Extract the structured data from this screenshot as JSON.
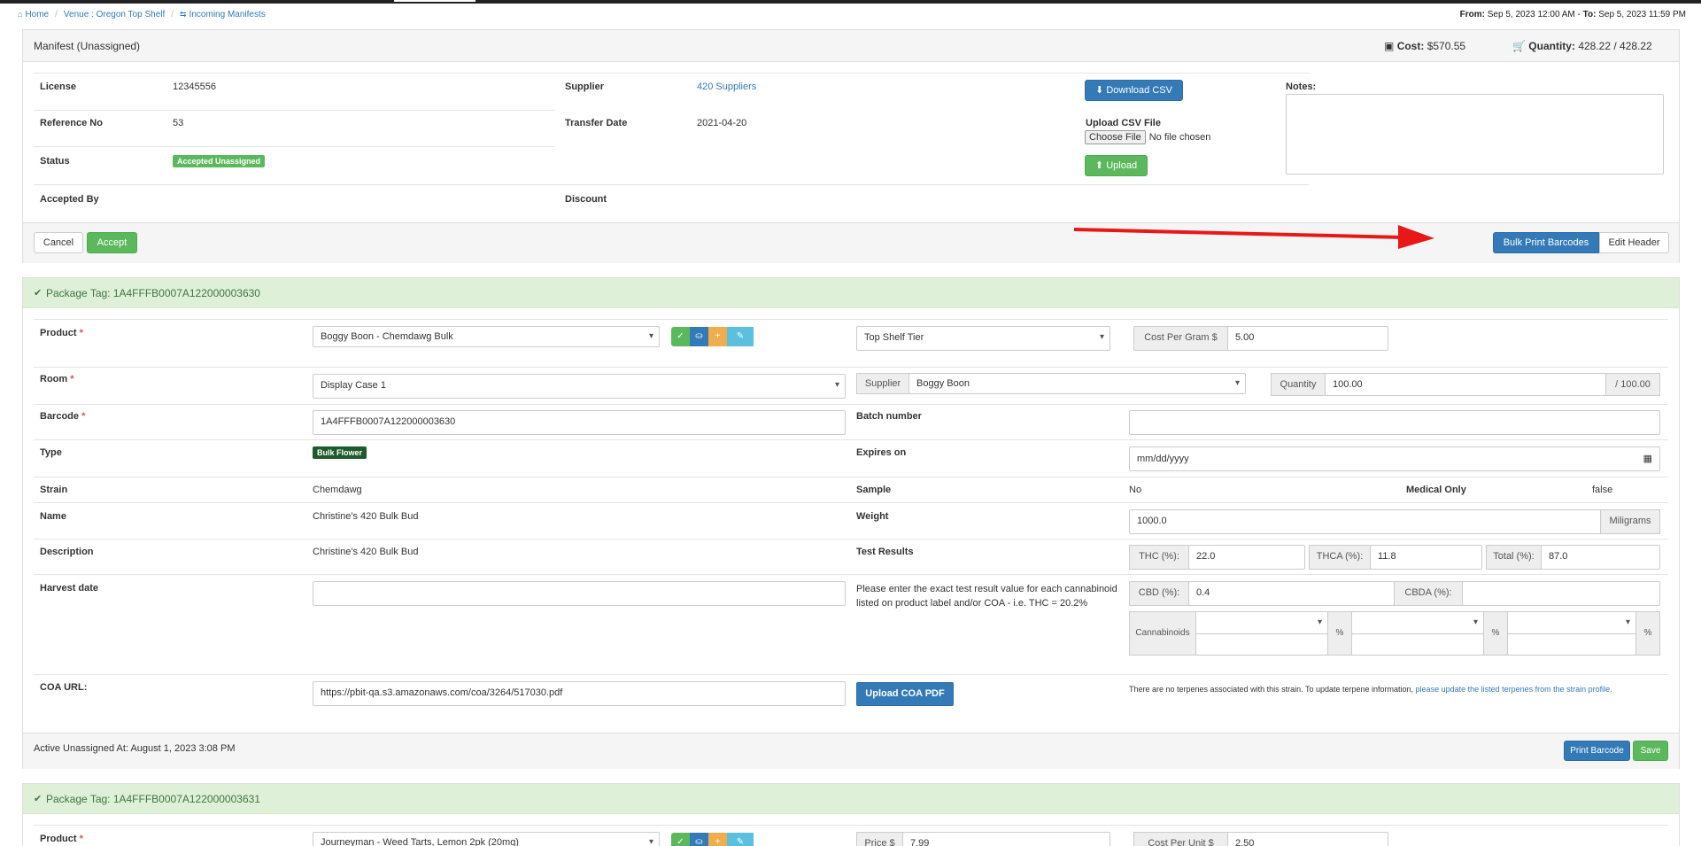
{
  "breadcrumb": {
    "home": "Home",
    "venue": "Venue : Oregon Top Shelf",
    "incoming": "Incoming Manifests"
  },
  "date_range": {
    "from_label": "From:",
    "from_value": "Sep 5, 2023 12:00 AM",
    "to_label": "To:",
    "to_value": "Sep 5, 2023 11:59 PM"
  },
  "manifest": {
    "title": "Manifest (Unassigned)",
    "cost_label": "Cost:",
    "cost_value": "$570.55",
    "qty_label": "Quantity:",
    "qty_value": "428.22 / 428.22",
    "license_label": "License",
    "license_value": "12345556",
    "reference_label": "Reference No",
    "reference_value": "53",
    "status_label": "Status",
    "status_value": "Accepted Unassigned",
    "accepted_by_label": "Accepted By",
    "supplier_label": "Supplier",
    "supplier_value": "420 Suppliers",
    "transfer_label": "Transfer Date",
    "transfer_value": "2021-04-20",
    "discount_label": "Discount",
    "download_csv": "Download CSV",
    "upload_csv_label": "Upload CSV File",
    "choose_file": "Choose File",
    "no_file": "No file chosen",
    "upload": "Upload",
    "notes_label": "Notes:",
    "cancel": "Cancel",
    "accept": "Accept",
    "bulk_print": "Bulk Print Barcodes",
    "edit_header": "Edit Header"
  },
  "package1": {
    "tag": "Package Tag: 1A4FFFB0007A122000003630",
    "product_label": "Product",
    "product_value": "Boggy Boon - Chemdawg Bulk",
    "tier_value": "Top Shelf Tier",
    "cost_per_gram_label": "Cost Per Gram $",
    "cost_per_gram_value": "5.00",
    "room_label": "Room",
    "room_value": "Display Case 1",
    "supplier_label": "Supplier",
    "supplier_value": "Boggy Boon",
    "quantity_label": "Quantity",
    "quantity_value": "100.00",
    "quantity_total": "/ 100.00",
    "barcode_label": "Barcode",
    "barcode_value": "1A4FFFB0007A122000003630",
    "batch_label": "Batch number",
    "type_label": "Type",
    "type_value": "Bulk Flower",
    "expires_label": "Expires on",
    "expires_placeholder": "mm/dd/yyyy",
    "strain_label": "Strain",
    "strain_value": "Chemdawg",
    "sample_label": "Sample",
    "sample_value": "No",
    "medical_label": "Medical Only",
    "medical_value": "false",
    "name_label": "Name",
    "name_value": "Christine's 420 Bulk Bud",
    "weight_label": "Weight",
    "weight_value": "1000.0",
    "weight_unit": "Miligrams",
    "description_label": "Description",
    "description_value": "Christine's 420 Bulk Bud",
    "test_label": "Test Results",
    "thc_label": "THC (%):",
    "thc_value": "22.0",
    "thca_label": "THCA (%):",
    "thca_value": "11.8",
    "total_label": "Total (%):",
    "total_value": "87.0",
    "harvest_label": "Harvest date",
    "test_note": "Please enter the exact test result value for each cannabinoid listed on product label and/or COA - i.e. THC = 20.2%",
    "cbd_label": "CBD (%):",
    "cbd_value": "0.4",
    "cbda_label": "CBDA (%):",
    "cannabinoids_label": "Cannabinoids",
    "percent": "%",
    "coa_label": "COA URL:",
    "coa_value": "https://pbit-qa.s3.amazonaws.com/coa/3264/517030.pdf",
    "upload_coa": "Upload COA PDF",
    "terpene_note": "There are no terpenes associated with this strain. To update terpene information,",
    "terpene_link": "please update the listed terpenes from the strain profile.",
    "active_unassigned": "Active Unassigned At: August 1, 2023 3:08 PM",
    "print_barcode": "Print Barcode",
    "save": "Save"
  },
  "package2": {
    "tag": "Package Tag: 1A4FFFB0007A122000003631",
    "product_label": "Product",
    "product_value": "Journeyman - Weed Tarts, Lemon 2pk (20mg)",
    "price_label": "Price $",
    "price_value": "7.99",
    "cost_per_unit_label": "Cost Per Unit $",
    "cost_per_unit_value": "2.50"
  },
  "colors": {
    "primary": "#337ab7",
    "success": "#5cb85c",
    "warning": "#f0ad4e",
    "info": "#5bc0de",
    "arrow": "#e81818",
    "panel_success_bg": "#dff0d8"
  }
}
